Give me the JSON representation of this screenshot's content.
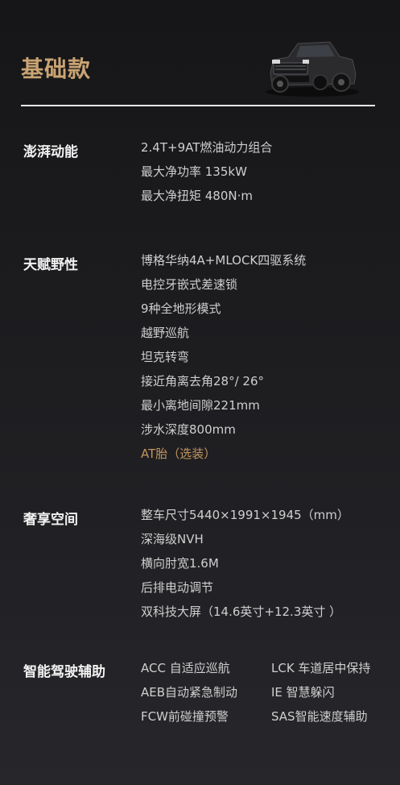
{
  "header": {
    "title": "基础款"
  },
  "sections": {
    "power": {
      "label": "澎湃动能",
      "items": [
        "2.4T+9AT燃油动力组合",
        "最大净功率 135kW",
        "最大净扭矩 480N·m"
      ]
    },
    "offroad": {
      "label": "天赋野性",
      "items": [
        "博格华纳4A+MLOCK四驱系统",
        "电控牙嵌式差速锁",
        "9种全地形模式",
        "越野巡航",
        "坦克转弯",
        "接近角离去角28°/ 26°",
        "最小离地间隙221mm",
        "涉水深度800mm"
      ],
      "optional": "AT胎（选装）"
    },
    "space": {
      "label": "奢享空间",
      "items": [
        "整车尺寸5440×1991×1945（mm）",
        "深海级NVH",
        "横向肘宽1.6M",
        "后排电动调节",
        "双科技大屏（14.6英寸+12.3英寸 ）"
      ]
    },
    "adas": {
      "label": "智能驾驶辅助",
      "items": [
        "ACC 自适应巡航",
        "LCK 车道居中保持",
        "AEB自动紧急制动",
        "IE 智慧躲闪",
        "FCW前碰撞预警",
        "SAS智能速度辅助"
      ]
    }
  },
  "colors": {
    "title": "#c9a473",
    "accent": "#c2955f",
    "background": "#1d1d20"
  }
}
